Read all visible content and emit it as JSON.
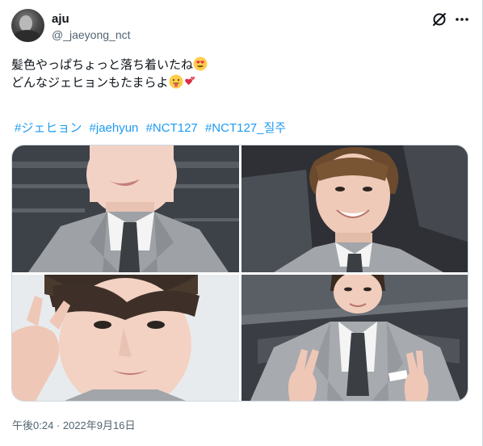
{
  "author": {
    "display_name": "aju",
    "handle": "@_jaeyong_nct"
  },
  "header": {
    "grok_icon": "grok-slash-icon",
    "more_icon": "more-dots-icon"
  },
  "tweet": {
    "line1": "髪色やっぱちょっと落ち着いたね",
    "line1_emoji": "heart-eyes-emoji",
    "line2": "どんなジェヒョンもたまらよ",
    "line2_emojis": [
      "tongue-out-emoji",
      "two-hearts-emoji"
    ],
    "hashtags": [
      "#ジェヒョン",
      "#jaehyun",
      "#NCT127",
      "#NCT127_질주"
    ]
  },
  "media": {
    "photo_count": 4
  },
  "timestamp": "午後0:24 · 2022年9月16日",
  "colors": {
    "link": "#1d9bf0",
    "secondary_text": "#536471",
    "border": "#cfd9de"
  }
}
